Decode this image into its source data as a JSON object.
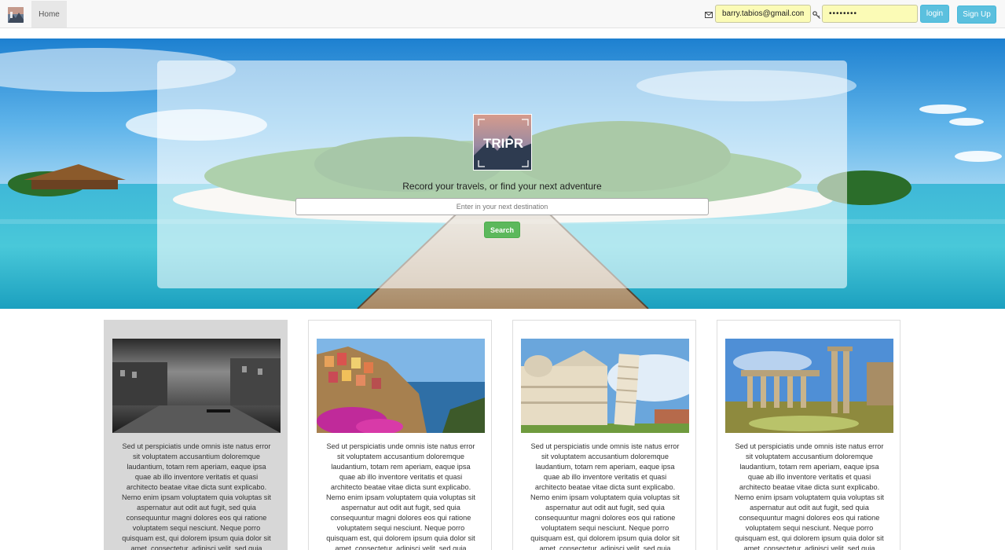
{
  "nav": {
    "logo_icon": "tripr-logo-icon",
    "home_label": "Home",
    "email_icon": "envelope-icon",
    "email_value": "barry.tabios@gmail.com",
    "password_icon": "key-icon",
    "password_value": "••••••••",
    "login_label": "login",
    "signup_label": "Sign Up"
  },
  "hero": {
    "logo_text": "TRIPR",
    "tagline": "Record your travels, or find your next adventure",
    "search_placeholder": "Enter in your next destination",
    "search_label": "Search"
  },
  "cards": [
    {
      "image": "venice-grand-canal-photo",
      "text": "Sed ut perspiciatis unde omnis iste natus error sit voluptatem accusantium doloremque laudantium, totam rem aperiam, eaque ipsa quae ab illo inventore veritatis et quasi architecto beatae vitae dicta sunt explicabo. Nemo enim ipsam voluptatem quia voluptas sit aspernatur aut odit aut fugit, sed quia consequuntur magni dolores eos qui ratione voluptatem sequi nesciunt. Neque porro quisquam est, qui dolorem ipsum quia dolor sit amet, consectetur, adipisci velit, sed quia"
    },
    {
      "image": "cinque-terre-photo",
      "text": "Sed ut perspiciatis unde omnis iste natus error sit voluptatem accusantium doloremque laudantium, totam rem aperiam, eaque ipsa quae ab illo inventore veritatis et quasi architecto beatae vitae dicta sunt explicabo. Nemo enim ipsam voluptatem quia voluptas sit aspernatur aut odit aut fugit, sed quia consequuntur magni dolores eos qui ratione voluptatem sequi nesciunt. Neque porro quisquam est, qui dolorem ipsum quia dolor sit amet, consectetur, adipisci velit, sed quia"
    },
    {
      "image": "pisa-tower-photo",
      "text": "Sed ut perspiciatis unde omnis iste natus error sit voluptatem accusantium doloremque laudantium, totam rem aperiam, eaque ipsa quae ab illo inventore veritatis et quasi architecto beatae vitae dicta sunt explicabo. Nemo enim ipsam voluptatem quia voluptas sit aspernatur aut odit aut fugit, sed quia consequuntur magni dolores eos qui ratione voluptatem sequi nesciunt. Neque porro quisquam est, qui dolorem ipsum quia dolor sit amet, consectetur, adipisci velit, sed quia"
    },
    {
      "image": "roman-forum-photo",
      "text": "Sed ut perspiciatis unde omnis iste natus error sit voluptatem accusantium doloremque laudantium, totam rem aperiam, eaque ipsa quae ab illo inventore veritatis et quasi architecto beatae vitae dicta sunt explicabo. Nemo enim ipsam voluptatem quia voluptas sit aspernatur aut odit aut fugit, sed quia consequuntur magni dolores eos qui ratione voluptatem sequi nesciunt. Neque porro quisquam est, qui dolorem ipsum quia dolor sit amet, consectetur, adipisci velit, sed quia"
    }
  ],
  "colors": {
    "info_button": "#5bc0de",
    "success_button": "#5cb85c",
    "autofill_input": "#fbfbb6",
    "active_card": "#d7d7d7"
  }
}
